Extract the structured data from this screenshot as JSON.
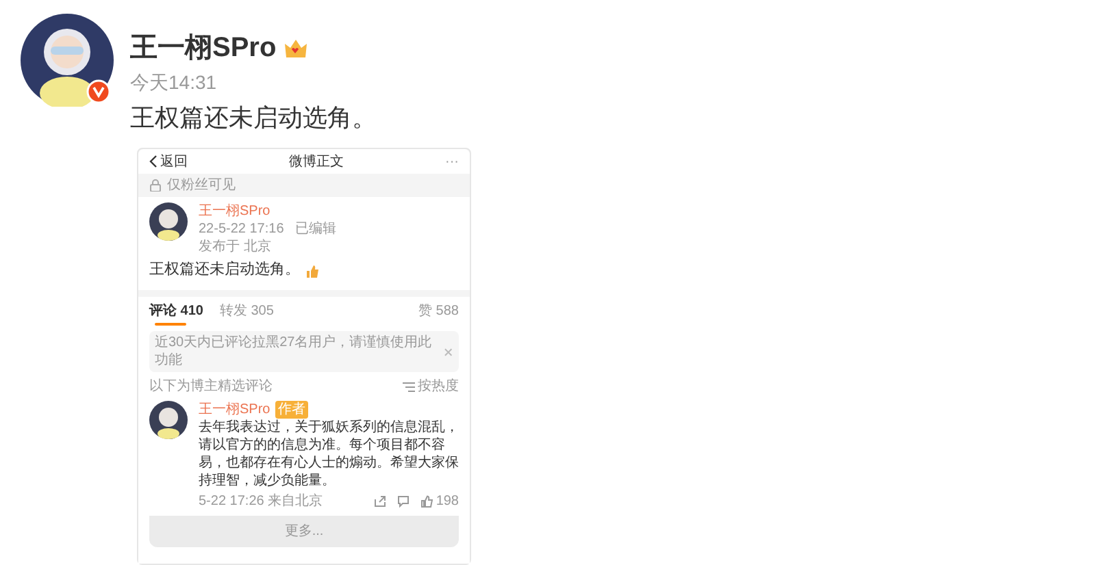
{
  "post": {
    "author": "王一栩SPro",
    "time": "今天14:31",
    "text": "王权篇还未启动选角。"
  },
  "screenshot": {
    "nav": {
      "back": "返回",
      "title": "微博正文",
      "more": "···"
    },
    "visibility": "仅粉丝可见",
    "post": {
      "author": "王一栩SPro",
      "time": "22-5-22 17:16",
      "edited": "已编辑",
      "location": "发布于 北京",
      "text": "王权篇还未启动选角。"
    },
    "tabs": [
      {
        "label": "评论 410",
        "selected": true
      },
      {
        "label": "转发 305",
        "selected": false
      }
    ],
    "likes": "赞 588",
    "notice": "近30天内已评论拉黑27名用户，请谨慎使用此功能",
    "section_label": "以下为博主精选评论",
    "sort": "按热度",
    "comment": {
      "author": "王一栩SPro",
      "badge": "作者",
      "text": "去年我表达过，关于狐妖系列的信息混乱，请以官方的的信息为准。每个项目都不容易，也都存在有心人士的煽动。希望大家保持理智，减少负能量。",
      "meta": "5-22 17:26 来自北京",
      "likes": "198"
    },
    "more": "更多..."
  }
}
